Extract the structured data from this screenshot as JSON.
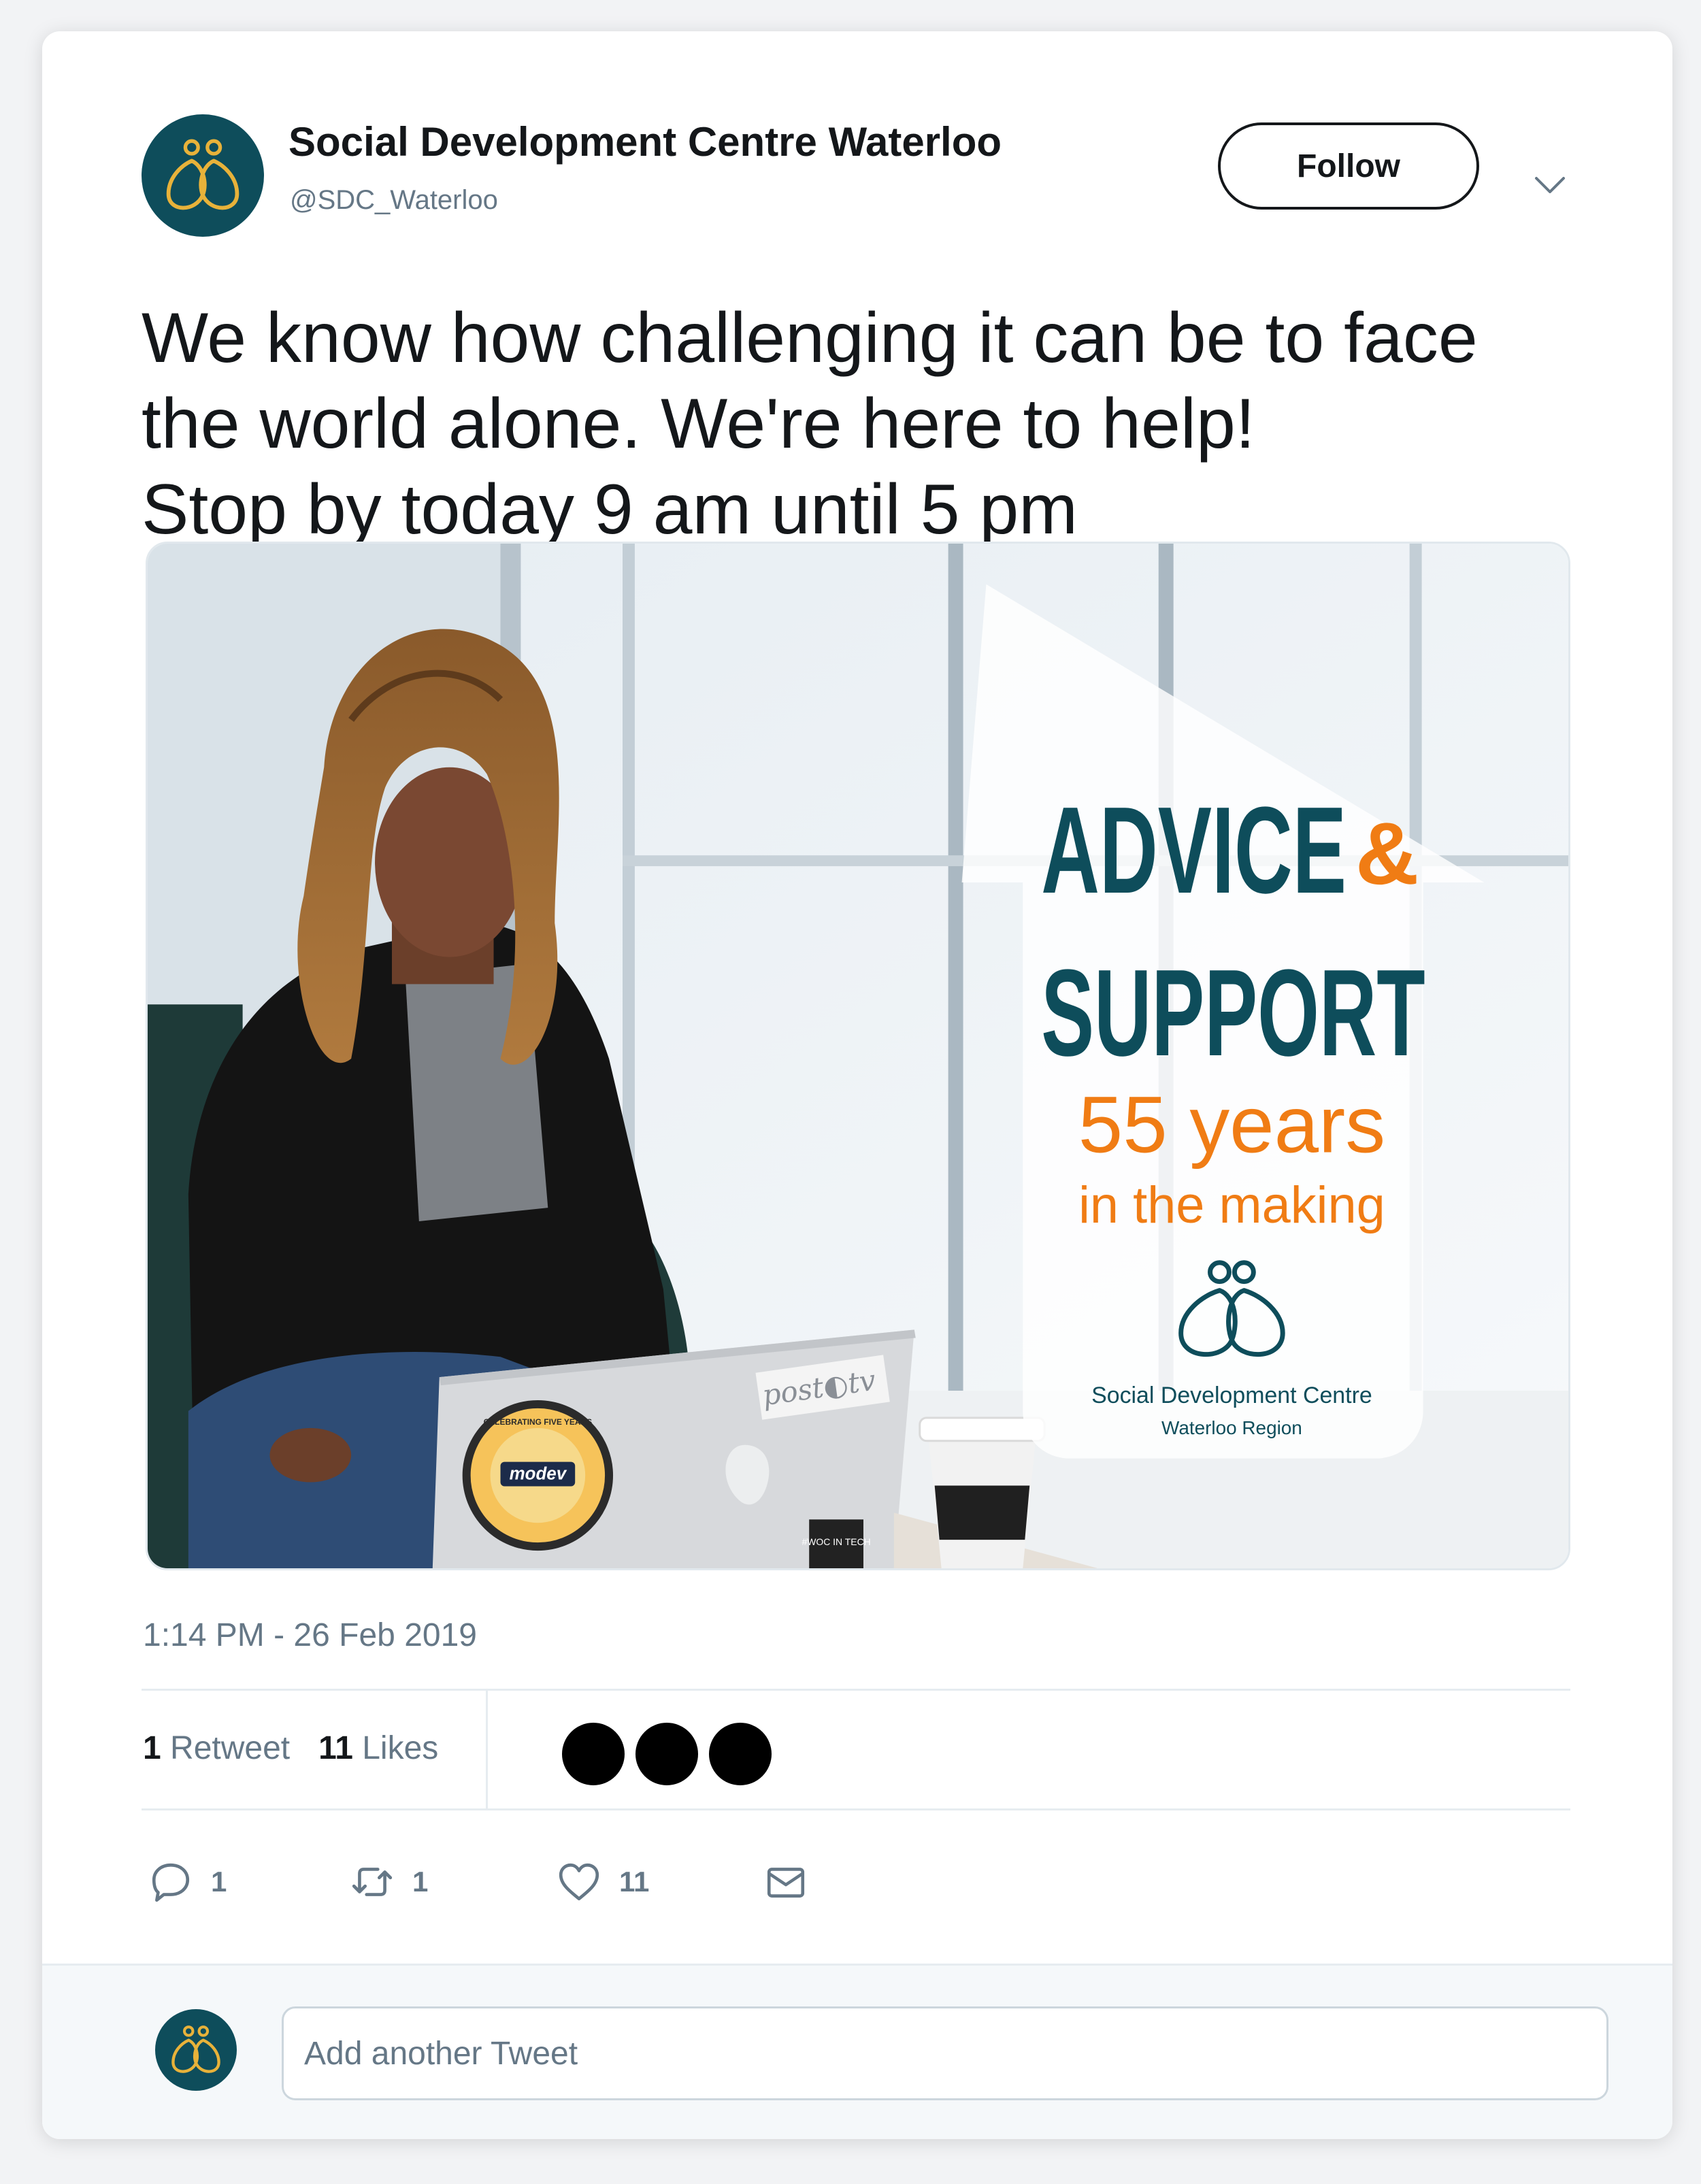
{
  "user": {
    "display_name": "Social Development Centre Waterloo",
    "handle": "@SDC_Waterloo",
    "avatar_icon": "sdc-logo-icon"
  },
  "header": {
    "follow_label": "Follow",
    "menu_icon": "chevron-down-icon"
  },
  "tweet": {
    "lines": [
      "We know how challenging it can be to face",
      "the world alone. We're here to help!",
      "Stop by today 9 am until 5 pm"
    ],
    "timestamp": "1:14 PM - 26 Feb 2019"
  },
  "media": {
    "headline_1": "ADVICE",
    "ampersand": "&",
    "headline_2": "SUPPORT",
    "years": "55 years",
    "making": "in the making",
    "org_name": "Social Development Centre",
    "org_region": "Waterloo Region",
    "laptop_brand": "post◐tv",
    "sticker_name": "modev",
    "sticker_ring": "CELEBRATING FIVE YEARS",
    "woc_sticker": "#WOC IN TECH",
    "colors": {
      "teal": "#0e4d5b",
      "orange": "#f07c14",
      "gold": "#e8b23a"
    }
  },
  "stats": {
    "retweet_count": "1",
    "retweet_label": "Retweet",
    "like_count": "11",
    "like_label": "Likes",
    "liker_count": 3
  },
  "actions": {
    "reply_count": "1",
    "retweet_count": "1",
    "like_count": "11",
    "reply_icon": "reply-icon",
    "retweet_icon": "retweet-icon",
    "like_icon": "heart-icon",
    "dm_icon": "envelope-icon"
  },
  "reply": {
    "placeholder": "Add another Tweet"
  }
}
